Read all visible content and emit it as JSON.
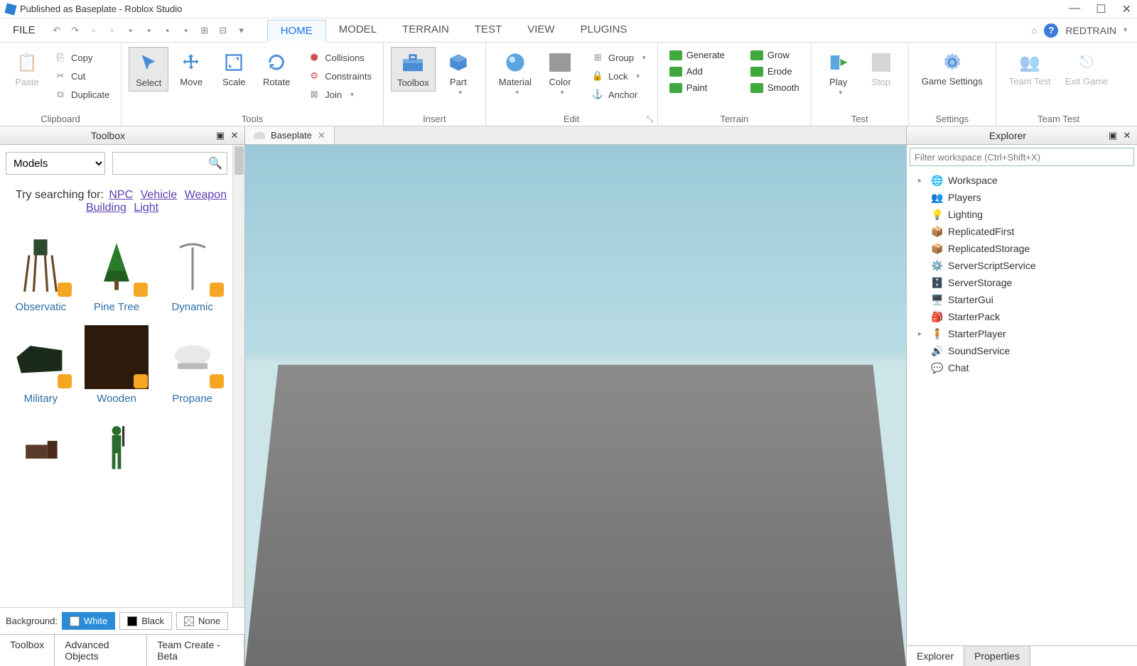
{
  "title": "Published as Baseplate - Roblox Studio",
  "menubar": {
    "file": "FILE",
    "tabs": [
      "HOME",
      "MODEL",
      "TERRAIN",
      "TEST",
      "VIEW",
      "PLUGINS"
    ],
    "active_tab": 0,
    "username": "REDTRAIN"
  },
  "ribbon": {
    "clipboard": {
      "paste": "Paste",
      "copy": "Copy",
      "cut": "Cut",
      "duplicate": "Duplicate",
      "label": "Clipboard"
    },
    "tools": {
      "select": "Select",
      "move": "Move",
      "scale": "Scale",
      "rotate": "Rotate",
      "collisions": "Collisions",
      "constraints": "Constraints",
      "join": "Join",
      "label": "Tools"
    },
    "insert": {
      "toolbox": "Toolbox",
      "part": "Part",
      "label": "Insert"
    },
    "edit": {
      "material": "Material",
      "color": "Color",
      "group": "Group",
      "lock": "Lock",
      "anchor": "Anchor",
      "label": "Edit"
    },
    "terrain": {
      "generate": "Generate",
      "add": "Add",
      "paint": "Paint",
      "grow": "Grow",
      "erode": "Erode",
      "smooth": "Smooth",
      "label": "Terrain"
    },
    "test": {
      "play": "Play",
      "stop": "Stop",
      "label": "Test"
    },
    "settings": {
      "game_settings": "Game Settings",
      "label": "Settings"
    },
    "teamtest": {
      "team_test": "Team Test",
      "exit_game": "Exit Game",
      "label": "Team Test"
    }
  },
  "toolbox": {
    "panel_title": "Toolbox",
    "dropdown": "Models",
    "search_placeholder": "",
    "suggest_label": "Try searching for:",
    "suggestions": [
      "NPC",
      "Vehicle",
      "Weapon",
      "Building",
      "Light"
    ],
    "items": [
      {
        "name": "Observatic"
      },
      {
        "name": "Pine Tree"
      },
      {
        "name": "Dynamic"
      },
      {
        "name": "Military"
      },
      {
        "name": "Wooden"
      },
      {
        "name": "Propane"
      }
    ],
    "background_label": "Background:",
    "bg_options": [
      "White",
      "Black",
      "None"
    ],
    "bottom_tabs": [
      "Toolbox",
      "Advanced Objects",
      "Team Create - Beta"
    ]
  },
  "viewport": {
    "tab_name": "Baseplate"
  },
  "explorer": {
    "panel_title": "Explorer",
    "filter_placeholder": "Filter workspace (Ctrl+Shift+X)",
    "nodes": [
      {
        "name": "Workspace",
        "icon": "globe",
        "expandable": true
      },
      {
        "name": "Players",
        "icon": "players",
        "expandable": false
      },
      {
        "name": "Lighting",
        "icon": "bulb",
        "expandable": false
      },
      {
        "name": "ReplicatedFirst",
        "icon": "box",
        "expandable": false
      },
      {
        "name": "ReplicatedStorage",
        "icon": "box",
        "expandable": false
      },
      {
        "name": "ServerScriptService",
        "icon": "gear",
        "expandable": false
      },
      {
        "name": "ServerStorage",
        "icon": "storage",
        "expandable": false
      },
      {
        "name": "StarterGui",
        "icon": "gui",
        "expandable": false
      },
      {
        "name": "StarterPack",
        "icon": "pack",
        "expandable": false
      },
      {
        "name": "StarterPlayer",
        "icon": "player",
        "expandable": true
      },
      {
        "name": "SoundService",
        "icon": "sound",
        "expandable": false
      },
      {
        "name": "Chat",
        "icon": "chat",
        "expandable": false
      }
    ],
    "bottom_tabs": [
      "Explorer",
      "Properties"
    ]
  }
}
